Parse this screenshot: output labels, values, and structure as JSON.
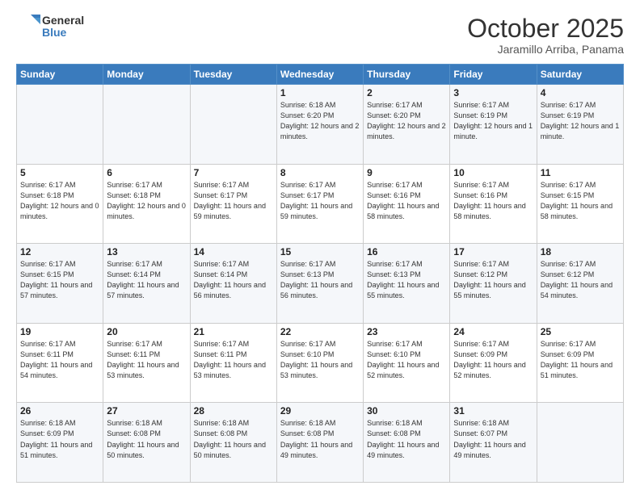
{
  "header": {
    "logo_general": "General",
    "logo_blue": "Blue",
    "month_title": "October 2025",
    "location": "Jaramillo Arriba, Panama"
  },
  "days_of_week": [
    "Sunday",
    "Monday",
    "Tuesday",
    "Wednesday",
    "Thursday",
    "Friday",
    "Saturday"
  ],
  "weeks": [
    [
      {
        "day": "",
        "sunrise": "",
        "sunset": "",
        "daylight": ""
      },
      {
        "day": "",
        "sunrise": "",
        "sunset": "",
        "daylight": ""
      },
      {
        "day": "",
        "sunrise": "",
        "sunset": "",
        "daylight": ""
      },
      {
        "day": "1",
        "sunrise": "Sunrise: 6:18 AM",
        "sunset": "Sunset: 6:20 PM",
        "daylight": "Daylight: 12 hours and 2 minutes."
      },
      {
        "day": "2",
        "sunrise": "Sunrise: 6:17 AM",
        "sunset": "Sunset: 6:20 PM",
        "daylight": "Daylight: 12 hours and 2 minutes."
      },
      {
        "day": "3",
        "sunrise": "Sunrise: 6:17 AM",
        "sunset": "Sunset: 6:19 PM",
        "daylight": "Daylight: 12 hours and 1 minute."
      },
      {
        "day": "4",
        "sunrise": "Sunrise: 6:17 AM",
        "sunset": "Sunset: 6:19 PM",
        "daylight": "Daylight: 12 hours and 1 minute."
      }
    ],
    [
      {
        "day": "5",
        "sunrise": "Sunrise: 6:17 AM",
        "sunset": "Sunset: 6:18 PM",
        "daylight": "Daylight: 12 hours and 0 minutes."
      },
      {
        "day": "6",
        "sunrise": "Sunrise: 6:17 AM",
        "sunset": "Sunset: 6:18 PM",
        "daylight": "Daylight: 12 hours and 0 minutes."
      },
      {
        "day": "7",
        "sunrise": "Sunrise: 6:17 AM",
        "sunset": "Sunset: 6:17 PM",
        "daylight": "Daylight: 11 hours and 59 minutes."
      },
      {
        "day": "8",
        "sunrise": "Sunrise: 6:17 AM",
        "sunset": "Sunset: 6:17 PM",
        "daylight": "Daylight: 11 hours and 59 minutes."
      },
      {
        "day": "9",
        "sunrise": "Sunrise: 6:17 AM",
        "sunset": "Sunset: 6:16 PM",
        "daylight": "Daylight: 11 hours and 58 minutes."
      },
      {
        "day": "10",
        "sunrise": "Sunrise: 6:17 AM",
        "sunset": "Sunset: 6:16 PM",
        "daylight": "Daylight: 11 hours and 58 minutes."
      },
      {
        "day": "11",
        "sunrise": "Sunrise: 6:17 AM",
        "sunset": "Sunset: 6:15 PM",
        "daylight": "Daylight: 11 hours and 58 minutes."
      }
    ],
    [
      {
        "day": "12",
        "sunrise": "Sunrise: 6:17 AM",
        "sunset": "Sunset: 6:15 PM",
        "daylight": "Daylight: 11 hours and 57 minutes."
      },
      {
        "day": "13",
        "sunrise": "Sunrise: 6:17 AM",
        "sunset": "Sunset: 6:14 PM",
        "daylight": "Daylight: 11 hours and 57 minutes."
      },
      {
        "day": "14",
        "sunrise": "Sunrise: 6:17 AM",
        "sunset": "Sunset: 6:14 PM",
        "daylight": "Daylight: 11 hours and 56 minutes."
      },
      {
        "day": "15",
        "sunrise": "Sunrise: 6:17 AM",
        "sunset": "Sunset: 6:13 PM",
        "daylight": "Daylight: 11 hours and 56 minutes."
      },
      {
        "day": "16",
        "sunrise": "Sunrise: 6:17 AM",
        "sunset": "Sunset: 6:13 PM",
        "daylight": "Daylight: 11 hours and 55 minutes."
      },
      {
        "day": "17",
        "sunrise": "Sunrise: 6:17 AM",
        "sunset": "Sunset: 6:12 PM",
        "daylight": "Daylight: 11 hours and 55 minutes."
      },
      {
        "day": "18",
        "sunrise": "Sunrise: 6:17 AM",
        "sunset": "Sunset: 6:12 PM",
        "daylight": "Daylight: 11 hours and 54 minutes."
      }
    ],
    [
      {
        "day": "19",
        "sunrise": "Sunrise: 6:17 AM",
        "sunset": "Sunset: 6:11 PM",
        "daylight": "Daylight: 11 hours and 54 minutes."
      },
      {
        "day": "20",
        "sunrise": "Sunrise: 6:17 AM",
        "sunset": "Sunset: 6:11 PM",
        "daylight": "Daylight: 11 hours and 53 minutes."
      },
      {
        "day": "21",
        "sunrise": "Sunrise: 6:17 AM",
        "sunset": "Sunset: 6:11 PM",
        "daylight": "Daylight: 11 hours and 53 minutes."
      },
      {
        "day": "22",
        "sunrise": "Sunrise: 6:17 AM",
        "sunset": "Sunset: 6:10 PM",
        "daylight": "Daylight: 11 hours and 53 minutes."
      },
      {
        "day": "23",
        "sunrise": "Sunrise: 6:17 AM",
        "sunset": "Sunset: 6:10 PM",
        "daylight": "Daylight: 11 hours and 52 minutes."
      },
      {
        "day": "24",
        "sunrise": "Sunrise: 6:17 AM",
        "sunset": "Sunset: 6:09 PM",
        "daylight": "Daylight: 11 hours and 52 minutes."
      },
      {
        "day": "25",
        "sunrise": "Sunrise: 6:17 AM",
        "sunset": "Sunset: 6:09 PM",
        "daylight": "Daylight: 11 hours and 51 minutes."
      }
    ],
    [
      {
        "day": "26",
        "sunrise": "Sunrise: 6:18 AM",
        "sunset": "Sunset: 6:09 PM",
        "daylight": "Daylight: 11 hours and 51 minutes."
      },
      {
        "day": "27",
        "sunrise": "Sunrise: 6:18 AM",
        "sunset": "Sunset: 6:08 PM",
        "daylight": "Daylight: 11 hours and 50 minutes."
      },
      {
        "day": "28",
        "sunrise": "Sunrise: 6:18 AM",
        "sunset": "Sunset: 6:08 PM",
        "daylight": "Daylight: 11 hours and 50 minutes."
      },
      {
        "day": "29",
        "sunrise": "Sunrise: 6:18 AM",
        "sunset": "Sunset: 6:08 PM",
        "daylight": "Daylight: 11 hours and 49 minutes."
      },
      {
        "day": "30",
        "sunrise": "Sunrise: 6:18 AM",
        "sunset": "Sunset: 6:08 PM",
        "daylight": "Daylight: 11 hours and 49 minutes."
      },
      {
        "day": "31",
        "sunrise": "Sunrise: 6:18 AM",
        "sunset": "Sunset: 6:07 PM",
        "daylight": "Daylight: 11 hours and 49 minutes."
      },
      {
        "day": "",
        "sunrise": "",
        "sunset": "",
        "daylight": ""
      }
    ]
  ]
}
